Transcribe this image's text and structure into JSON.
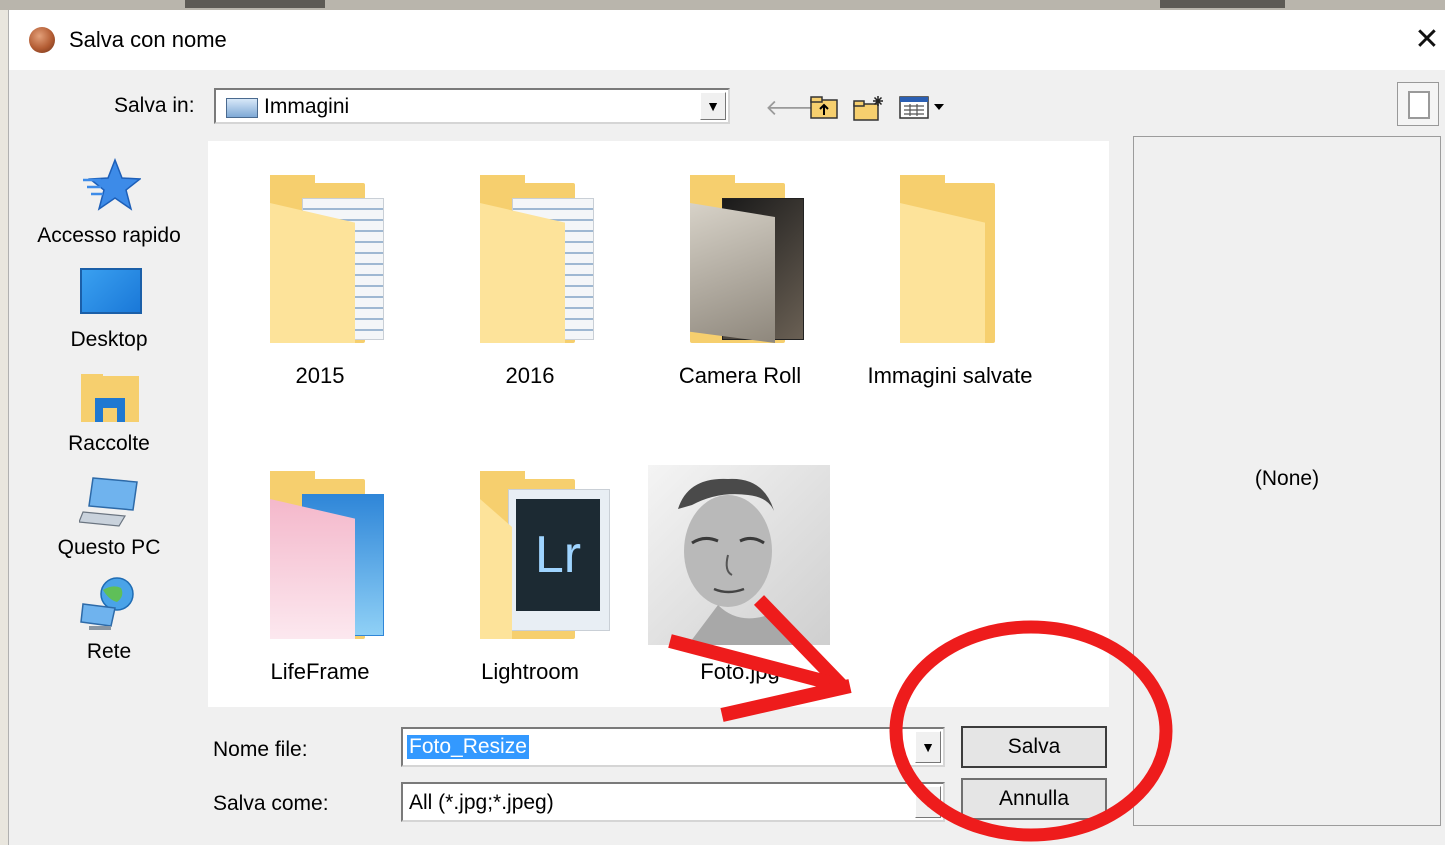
{
  "dialog": {
    "title": "Salva con nome",
    "close_glyph": "✕"
  },
  "savein": {
    "label": "Salva in:",
    "value": "Immagini",
    "toolbar": {
      "back": "🡐",
      "up": "⮤",
      "new_folder": "✱",
      "view": "▦▾"
    }
  },
  "places": [
    {
      "label": "Accesso rapido",
      "icon": "star-icon"
    },
    {
      "label": "Desktop",
      "icon": "desktop-icon"
    },
    {
      "label": "Raccolte",
      "icon": "libraries-icon"
    },
    {
      "label": "Questo PC",
      "icon": "computer-icon"
    },
    {
      "label": "Rete",
      "icon": "network-icon"
    }
  ],
  "files": [
    {
      "label": "2015",
      "kind": "folder-with-images"
    },
    {
      "label": "2016",
      "kind": "folder-with-images"
    },
    {
      "label": "Camera Roll",
      "kind": "folder-with-photo"
    },
    {
      "label": "Immagini salvate",
      "kind": "folder-empty"
    },
    {
      "label": "LifeFrame",
      "kind": "folder-colored"
    },
    {
      "label": "Lightroom",
      "kind": "folder-lightroom",
      "badge": "Lr"
    },
    {
      "label": "Foto.jpg",
      "kind": "image-thumbnail"
    }
  ],
  "preview": {
    "text": "(None)"
  },
  "form": {
    "filename_label": "Nome file:",
    "filename_value": "Foto_Resize",
    "filetype_label": "Salva come:",
    "filetype_value": "All (*.jpg;*.jpeg)",
    "save_button": "Salva",
    "cancel_button": "Annulla"
  },
  "colors": {
    "annotation_red": "#ee1c1c",
    "selection_blue": "#3399ff",
    "folder_yellow": "#f6cf6e"
  }
}
